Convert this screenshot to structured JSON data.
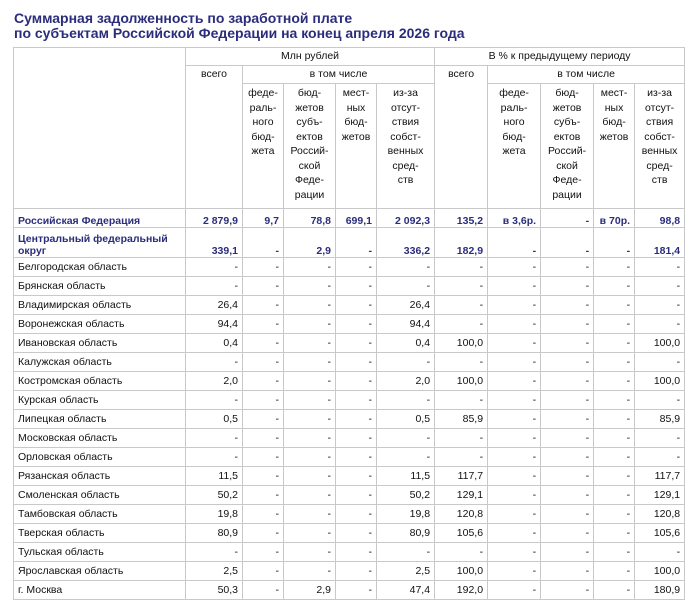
{
  "title_line1": "Суммарная задолженность по заработной плате",
  "title_line2": "по субъектам Российской Федерации на конец апреля 2026 года",
  "header": {
    "group1": "Млн рублей",
    "group2": "В % к предыдущему периоду",
    "total": "всего",
    "including": "в том числе",
    "federal": "феде-\nраль-\nного\nбюд-\nжета",
    "subjects": "бюд-\nжетов\nсубъ-\nектов\nРоссий-\nской\nФеде-\nрации",
    "local": "мест-\nных\nбюд-\nжетов",
    "own": "из-за\nотсут-\nствия\nсобст-\nвенных\nсред-\nств"
  },
  "rows": [
    {
      "name": "Российская Федерация",
      "v": [
        "2 879,9",
        "9,7",
        "78,8",
        "699,1",
        "2 092,3",
        "135,2",
        "в 3,6р.",
        "-",
        "в 70р.",
        "98,8"
      ]
    },
    {
      "name": "Центральный федеральный округ",
      "v": [
        "339,1",
        "-",
        "2,9",
        "-",
        "336,2",
        "182,9",
        "-",
        "-",
        "-",
        "181,4"
      ]
    },
    {
      "name": "Белгородская область",
      "v": [
        "-",
        "-",
        "-",
        "-",
        "-",
        "-",
        "-",
        "-",
        "-",
        "-"
      ]
    },
    {
      "name": "Брянская область",
      "v": [
        "-",
        "-",
        "-",
        "-",
        "-",
        "-",
        "-",
        "-",
        "-",
        "-"
      ]
    },
    {
      "name": "Владимирская область",
      "v": [
        "26,4",
        "-",
        "-",
        "-",
        "26,4",
        "-",
        "-",
        "-",
        "-",
        "-"
      ]
    },
    {
      "name": "Воронежская область",
      "v": [
        "94,4",
        "-",
        "-",
        "-",
        "94,4",
        "-",
        "-",
        "-",
        "-",
        "-"
      ]
    },
    {
      "name": "Ивановская область",
      "v": [
        "0,4",
        "-",
        "-",
        "-",
        "0,4",
        "100,0",
        "-",
        "-",
        "-",
        "100,0"
      ]
    },
    {
      "name": "Калужская область",
      "v": [
        "-",
        "-",
        "-",
        "-",
        "-",
        "-",
        "-",
        "-",
        "-",
        "-"
      ]
    },
    {
      "name": "Костромская область",
      "v": [
        "2,0",
        "-",
        "-",
        "-",
        "2,0",
        "100,0",
        "-",
        "-",
        "-",
        "100,0"
      ]
    },
    {
      "name": "Курская область",
      "v": [
        "-",
        "-",
        "-",
        "-",
        "-",
        "-",
        "-",
        "-",
        "-",
        "-"
      ]
    },
    {
      "name": "Липецкая область",
      "v": [
        "0,5",
        "-",
        "-",
        "-",
        "0,5",
        "85,9",
        "-",
        "-",
        "-",
        "85,9"
      ]
    },
    {
      "name": "Московская область",
      "v": [
        "-",
        "-",
        "-",
        "-",
        "-",
        "-",
        "-",
        "-",
        "-",
        "-"
      ]
    },
    {
      "name": "Орловская область",
      "v": [
        "-",
        "-",
        "-",
        "-",
        "-",
        "-",
        "-",
        "-",
        "-",
        "-"
      ]
    },
    {
      "name": "Рязанская область",
      "v": [
        "11,5",
        "-",
        "-",
        "-",
        "11,5",
        "117,7",
        "-",
        "-",
        "-",
        "117,7"
      ]
    },
    {
      "name": "Смоленская область",
      "v": [
        "50,2",
        "-",
        "-",
        "-",
        "50,2",
        "129,1",
        "-",
        "-",
        "-",
        "129,1"
      ]
    },
    {
      "name": "Тамбовская область",
      "v": [
        "19,8",
        "-",
        "-",
        "-",
        "19,8",
        "120,8",
        "-",
        "-",
        "-",
        "120,8"
      ]
    },
    {
      "name": "Тверская область",
      "v": [
        "80,9",
        "-",
        "-",
        "-",
        "80,9",
        "105,6",
        "-",
        "-",
        "-",
        "105,6"
      ]
    },
    {
      "name": "Тульская область",
      "v": [
        "-",
        "-",
        "-",
        "-",
        "-",
        "-",
        "-",
        "-",
        "-",
        "-"
      ]
    },
    {
      "name": "Ярославская область",
      "v": [
        "2,5",
        "-",
        "-",
        "-",
        "2,5",
        "100,0",
        "-",
        "-",
        "-",
        "100,0"
      ]
    },
    {
      "name": "г. Москва",
      "v": [
        "50,3",
        "-",
        "2,9",
        "-",
        "47,4",
        "192,0",
        "-",
        "-",
        "-",
        "180,9"
      ]
    }
  ]
}
